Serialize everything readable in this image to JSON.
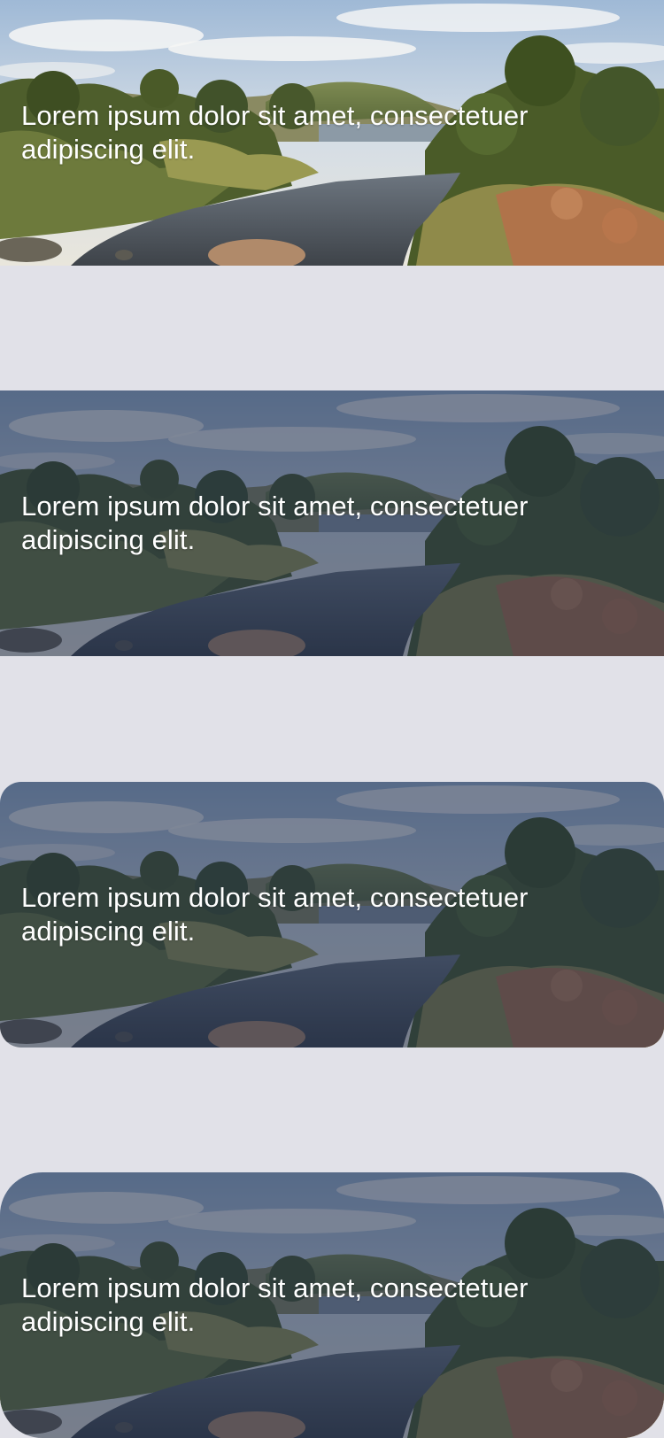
{
  "cards": [
    {
      "caption": "Lorem ipsum dolor sit amet, consectetuer adipiscing elit.",
      "dimmed": false,
      "corner": "none"
    },
    {
      "caption": "Lorem ipsum dolor sit amet, consectetuer adipiscing elit.",
      "dimmed": true,
      "corner": "none"
    },
    {
      "caption": "Lorem ipsum dolor sit amet, consectetuer adipiscing elit.",
      "dimmed": true,
      "corner": "rounded"
    },
    {
      "caption": "Lorem ipsum dolor sit amet, consectetuer adipiscing elit.",
      "dimmed": true,
      "corner": "large-rounded"
    }
  ],
  "colors": {
    "background": "#e1e1e8",
    "caption": "#ffffff",
    "dim_overlay": "#1c2a48"
  },
  "image_subject": "river-landscape-photo"
}
